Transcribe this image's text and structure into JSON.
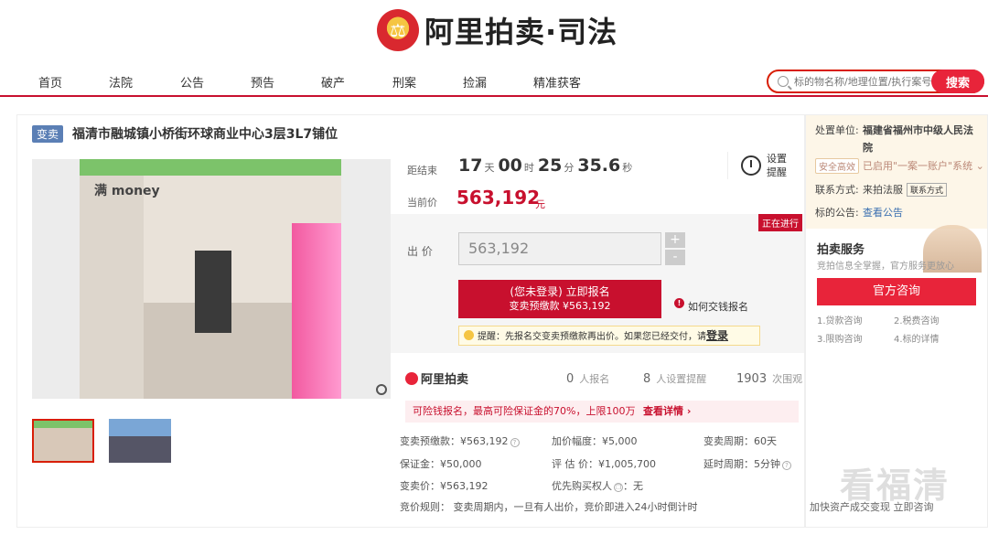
{
  "logo": {
    "text": "阿里拍卖·司法"
  },
  "nav": {
    "items": [
      "首页",
      "法院",
      "公告",
      "预告",
      "破产",
      "刑案",
      "捡漏",
      "精准获客"
    ],
    "search_placeholder": "标的物名称/地理位置/执行案号",
    "search_button": "搜索"
  },
  "listing": {
    "tag": "变卖",
    "title": "福清市融城镇小桥街环球商业中心3层3L7铺位",
    "photo_sign": "满 money"
  },
  "timer": {
    "label": "距结束",
    "days": "17",
    "days_unit": "天",
    "hours": "00",
    "hours_unit": "时",
    "minutes": "25",
    "minutes_unit": "分",
    "seconds": "35.6",
    "seconds_unit": "秒",
    "alarm_label": "设置提醒"
  },
  "price": {
    "label": "当前价",
    "value": "563,192",
    "unit": "元"
  },
  "bid": {
    "status": "正在进行",
    "label": "出 价",
    "value": "563,192",
    "plus": "+",
    "minus": "-",
    "signup_main": "(您未登录) 立即报名",
    "signup_sub": "变卖预缴款 ¥563,192",
    "how_pay": "如何交钱报名",
    "tip_text": "提醒：先报名交变卖预缴款再出价。如果您已经交付，请",
    "tip_login": "登录"
  },
  "stats": {
    "brand": "阿里拍卖",
    "signups": "0",
    "signups_label": "人报名",
    "reminders": "8",
    "reminders_label": "人设置提醒",
    "views": "1903",
    "views_label": "次围观"
  },
  "promo": {
    "text": "可险钱报名，最高可险保证金的70%，上限100万",
    "detail": "查看详情 ›"
  },
  "details": {
    "deposit": "变卖预缴款：¥563,192",
    "increment": "加价幅度：¥5,000",
    "period": "变卖周期：60天",
    "guarantee": "保证金：¥50,000",
    "appraisal": "评 估 价：¥1,005,700",
    "delay": "延时周期：5分钟",
    "sale_price": "变卖价：¥563,192",
    "priority": "优先购买权人",
    "priority_value": "：无",
    "rule": "竞价规则： 变卖周期内，一旦有人出价，竞价即进入24小时倒计时"
  },
  "side": {
    "unit_label": "处置单位:",
    "unit_line1": "福建省福州市中级人民法",
    "unit_line2": "院",
    "security": "安全高效",
    "account": "已启用\"一案一账户\"系统 ⌄",
    "contact_label": "联系方式:",
    "contact_value": "来拍法服",
    "contact_button": "联系方式",
    "notice_label": "标的公告:",
    "notice_link": "查看公告",
    "service_title": "拍卖服务",
    "service_sub": "竞拍信息全掌握，官方服务更放心",
    "consult_button": "官方咨询",
    "svc": [
      "1.贷款咨询",
      "2.税费咨询",
      "3.限购咨询",
      "4.标的详情"
    ],
    "bottom": "加快资产成交变现 立即咨询"
  },
  "watermark": "看福清"
}
